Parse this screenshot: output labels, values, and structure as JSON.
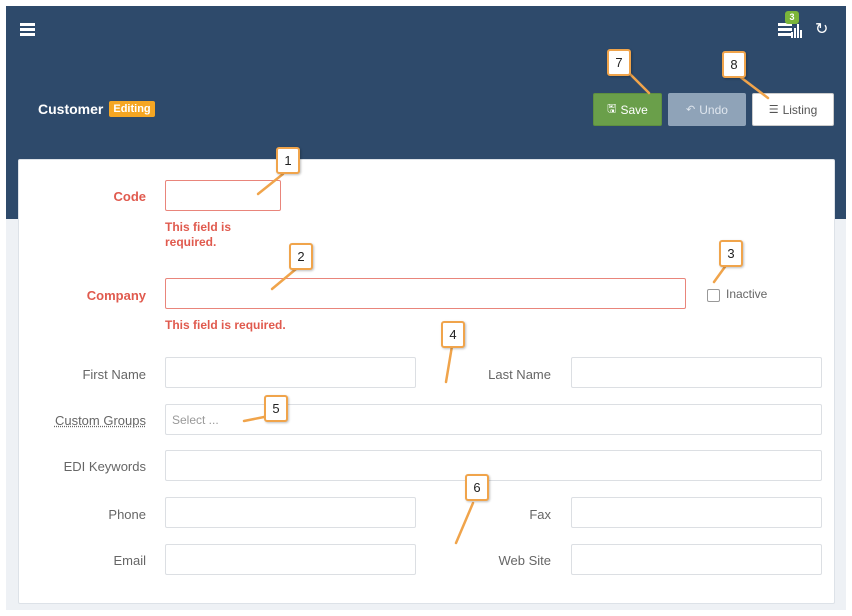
{
  "header": {
    "title": "Customer",
    "status": "Editing",
    "notification_count": "3",
    "icons": [
      "menu-icon",
      "chart-icon",
      "list-icon",
      "refresh-icon"
    ]
  },
  "toolbar": {
    "save_label": "Save",
    "undo_label": "Undo",
    "listing_label": "Listing"
  },
  "form": {
    "code_label": "Code",
    "code_error": "This field is required.",
    "company_label": "Company",
    "company_error": "This field is required.",
    "inactive_label": "Inactive",
    "first_name_label": "First Name",
    "last_name_label": "Last Name",
    "custom_groups_label": "Custom Groups",
    "custom_groups_placeholder": "Select ...",
    "edi_keywords_label": "EDI Keywords",
    "phone_label": "Phone",
    "fax_label": "Fax",
    "email_label": "Email",
    "web_site_label": "Web Site"
  },
  "callouts": [
    "1",
    "2",
    "3",
    "4",
    "5",
    "6",
    "7",
    "8"
  ],
  "colors": {
    "header_bg": "#2e4a6b",
    "save_green": "#6a9f4a",
    "editing_badge": "#f5a623",
    "error_red": "#e05a4e",
    "callout_border": "#f0a44b"
  }
}
